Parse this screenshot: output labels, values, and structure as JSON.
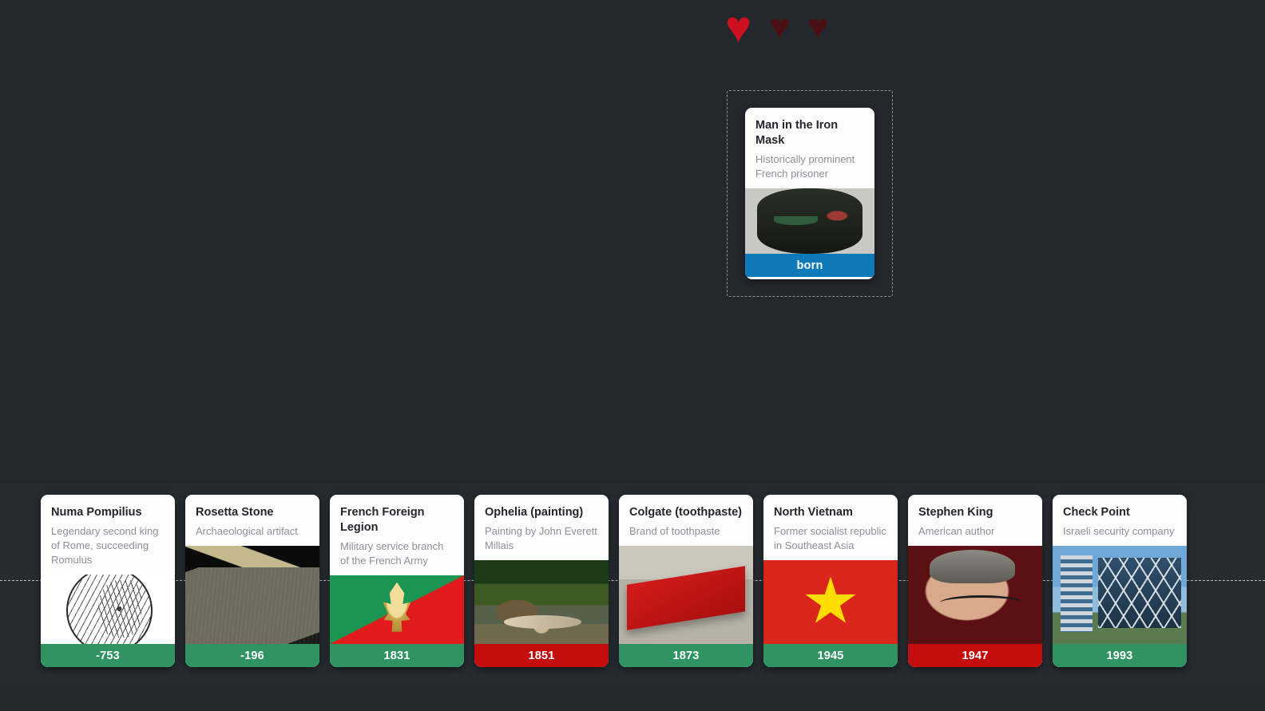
{
  "game": {
    "background_color": "#24282e",
    "lives": {
      "full_icon": "heart-filled-icon",
      "empty_icon": "heart-empty-icon",
      "full_count": 1,
      "total": 3,
      "full_color": "#cc1020",
      "empty_color": "#4a1014",
      "hearts": [
        {
          "state": "full",
          "glyph": "♥"
        },
        {
          "state": "empty",
          "glyph": "♥"
        },
        {
          "state": "empty",
          "glyph": "♥"
        }
      ]
    }
  },
  "drop_zone": {
    "label": "card-drop-zone",
    "border_style": "dashed"
  },
  "drag_card": {
    "title": "Man in the Iron Mask",
    "description": "Historically prominent French prisoner",
    "footer_label": "born",
    "footer_color": "#0e7ab8",
    "image_name": "iron-mask-prison-painting"
  },
  "timeline": {
    "line_style": "dashed",
    "line_color": "#b8bbc2",
    "colors": {
      "correct": "#2f9461",
      "incorrect": "#c40d0d"
    },
    "cards": [
      {
        "title": "Numa Pompilius",
        "description": "Legendary second king of Rome, succeeding Romulus",
        "year": "-753",
        "status": "correct",
        "image_name": "roman-coin-engraving"
      },
      {
        "title": "Rosetta Stone",
        "description": "Archaeological artifact",
        "year": "-196",
        "status": "correct",
        "image_name": "rosetta-stone-photo"
      },
      {
        "title": "French Foreign Legion",
        "description": "Military service branch of the French Army",
        "year": "1831",
        "status": "correct",
        "image_name": "legion-flame-emblem-flag"
      },
      {
        "title": "Ophelia (painting)",
        "description": "Painting by John Everett Millais",
        "year": "1851",
        "status": "incorrect",
        "image_name": "ophelia-painting"
      },
      {
        "title": "Colgate (toothpaste)",
        "description": "Brand of toothpaste",
        "year": "1873",
        "status": "correct",
        "image_name": "colgate-toothpaste-box"
      },
      {
        "title": "North Vietnam",
        "description": "Former socialist republic in Southeast Asia",
        "year": "1945",
        "status": "correct",
        "image_name": "north-vietnam-flag"
      },
      {
        "title": "Stephen King",
        "description": "American author",
        "year": "1947",
        "status": "incorrect",
        "image_name": "stephen-king-portrait"
      },
      {
        "title": "Check Point",
        "description": "Israeli security company",
        "year": "1993",
        "status": "correct",
        "image_name": "check-point-headquarters-building"
      }
    ]
  }
}
